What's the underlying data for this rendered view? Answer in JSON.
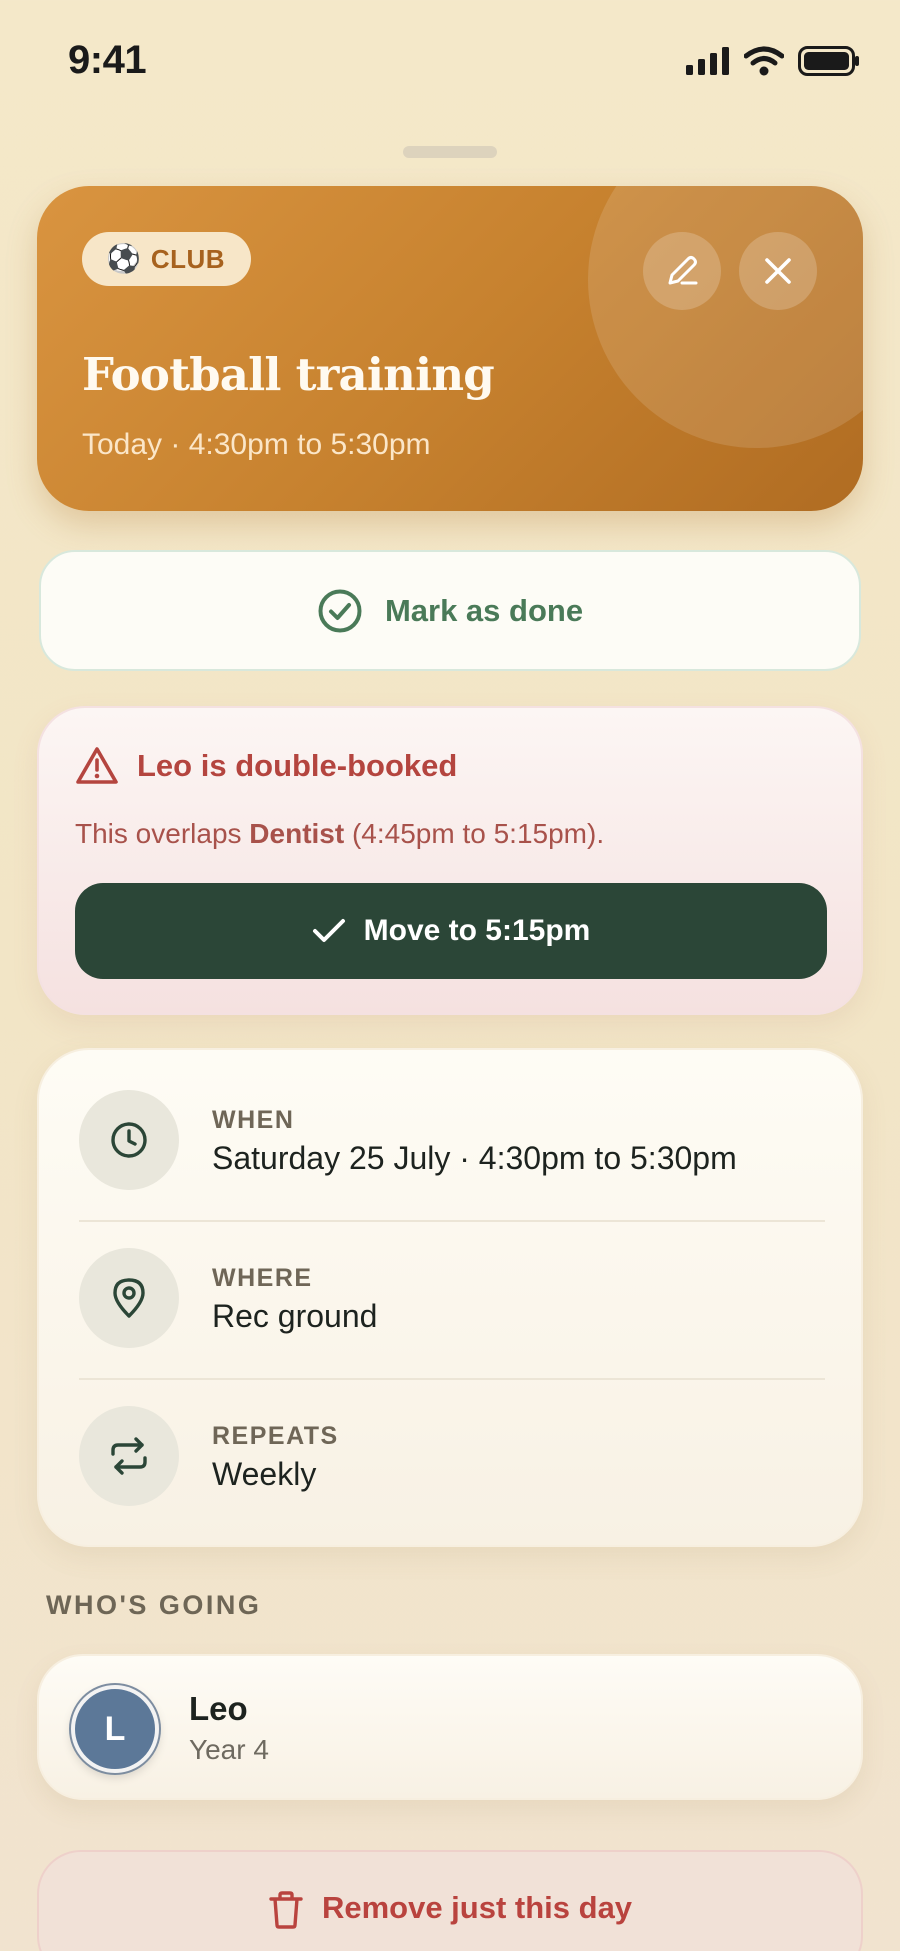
{
  "status_bar": {
    "time": "9:41"
  },
  "hero": {
    "badge_icon": "soccer-ball-icon",
    "badge_emoji": "⚽",
    "badge_label": "CLUB",
    "title": "Football training",
    "subtitle": "Today · 4:30pm to 5:30pm",
    "edit_icon": "pencil-icon",
    "close_icon": "close-icon"
  },
  "mark_done": {
    "label": "Mark as done",
    "icon": "check-circle-icon"
  },
  "conflict": {
    "icon": "warning-triangle-icon",
    "title": "Leo is double-booked",
    "text_prefix": "This overlaps ",
    "text_bold": "Dentist",
    "text_suffix": " (4:45pm to 5:15pm).",
    "action_label": "Move to 5:15pm",
    "action_icon": "check-icon"
  },
  "details": [
    {
      "icon": "clock-icon",
      "label": "WHEN",
      "value": "Saturday 25 July · 4:30pm to 5:30pm"
    },
    {
      "icon": "location-pin-icon",
      "label": "WHERE",
      "value": "Rec ground"
    },
    {
      "icon": "repeat-icon",
      "label": "REPEATS",
      "value": "Weekly"
    }
  ],
  "whos_going": {
    "title": "WHO'S GOING",
    "people": [
      {
        "initial": "L",
        "name": "Leo",
        "sub": "Year 4"
      }
    ]
  },
  "remove": {
    "label": "Remove just this day",
    "icon": "trash-icon"
  },
  "colors": {
    "accent_orange": "#c7822f",
    "success_green": "#4a7a58",
    "danger_red": "#b4453f",
    "dark_green": "#2b4637"
  }
}
